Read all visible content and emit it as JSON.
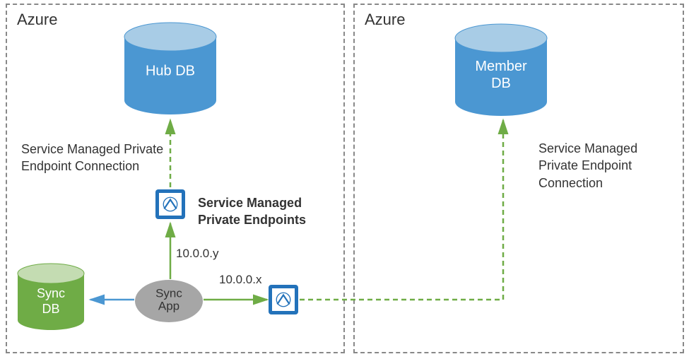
{
  "boxes": {
    "left_title": "Azure",
    "right_title": "Azure"
  },
  "databases": {
    "hub": "Hub DB",
    "member": "Member\nDB",
    "sync": "Sync\nDB"
  },
  "sync_app": "Sync\nApp",
  "labels": {
    "left_endpoint": "Service Managed Private Endpoint Connection",
    "right_endpoint": "Service Managed Private Endpoint Connection",
    "endpoints_title": "Service Managed Private Endpoints",
    "ip_y": "10.0.0.y",
    "ip_x": "10.0.0.x"
  },
  "colors": {
    "blue_db": "#4B97D2",
    "blue_db_top": "#A8CCE6",
    "green_db": "#6FAC46",
    "green_db_top": "#C4DCB2",
    "grey_app": "#A6A6A6",
    "green_arrow": "#6FAC46",
    "blue_arrow": "#4B97D2",
    "icon_bg": "#2372BA"
  }
}
